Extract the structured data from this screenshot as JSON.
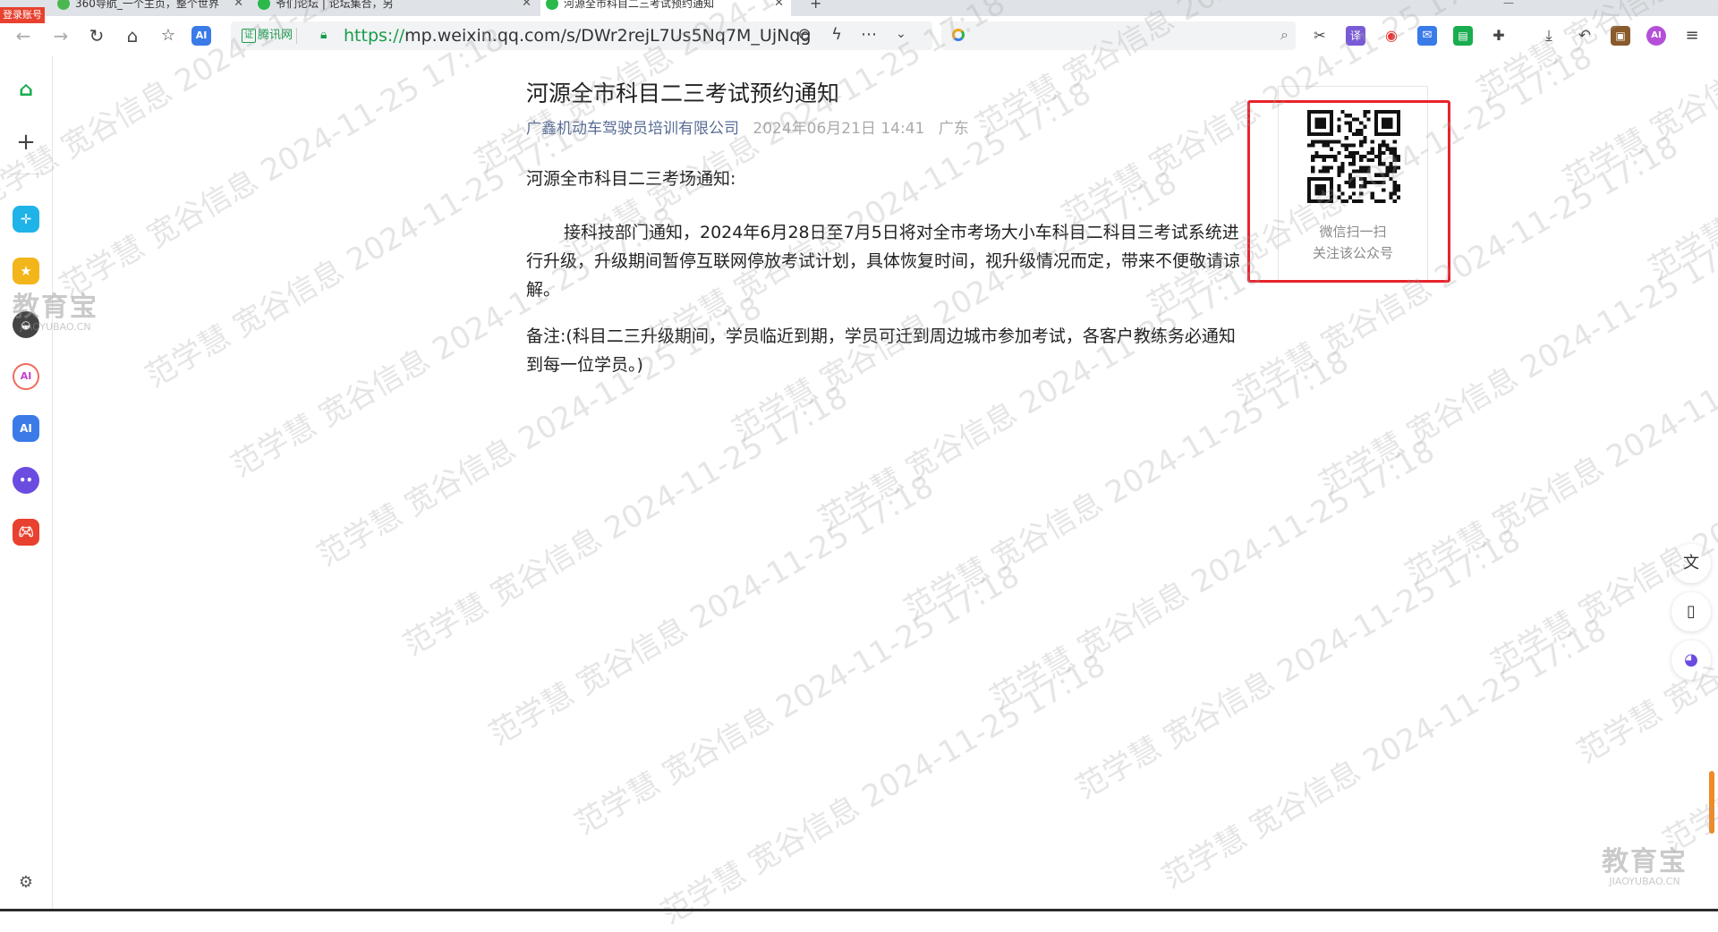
{
  "browser": {
    "login_badge": "登录账号",
    "tabs": [
      {
        "title": "360导航_一个主页，整个世界",
        "active": false
      },
      {
        "title": "爷们论坛 | 论坛集合，另",
        "active": false
      },
      {
        "title": "河源全市科目二三考试预约通知",
        "active": true
      }
    ],
    "address": {
      "cert_label": "腾讯网",
      "url_scheme": "https://",
      "url_rest": "mp.weixin.qq.com/s/DWr2rejL7Us5Nq7M_UjNqg"
    },
    "search": {
      "placeholder": ""
    }
  },
  "article": {
    "title": "河源全市科目二三考试预约通知",
    "author": "广鑫机动车驾驶员培训有限公司",
    "date": "2024年06月21日 14:41",
    "location": "广东",
    "paragraphs": [
      "河源全市科目二三考场通知:",
      "接科技部门通知，2024年6月28日至7月5日将对全市考场大小车科目二科目三考试系统进行升级，升级期间暂停互联网停放考试计划，具体恢复时间，视升级情况而定，带来不便敬请谅解。",
      "备注:(科目二三升级期间，学员临近到期，学员可迁到周边城市参加考试，各客户教练务必通知到每一位学员。)"
    ]
  },
  "qr_panel": {
    "line1": "微信扫一扫",
    "line2": "关注该公众号"
  },
  "watermark": {
    "text": "范学慧 宽谷信息 2024-11-25 17:18",
    "logo_big": "教育宝",
    "logo_small": "JIAOYUBAO.CN"
  },
  "colors": {
    "link_green": "#1a9b4a",
    "author_blue": "#576b95",
    "highlight_red": "#e8232b"
  }
}
